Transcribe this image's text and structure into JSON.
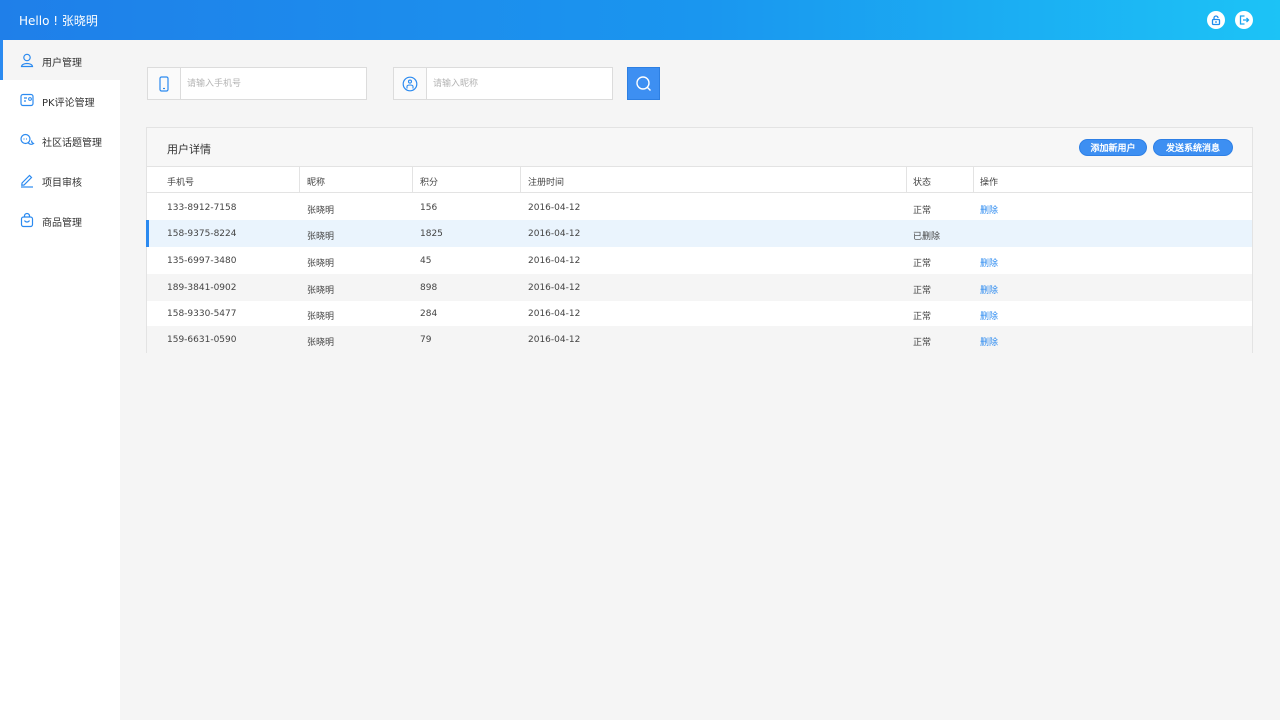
{
  "header": {
    "greeting": "Hello ! 张晓明",
    "lock_icon": "lock-icon",
    "logout_icon": "logout-icon"
  },
  "sidebar": {
    "items": [
      {
        "label": "用户管理",
        "icon": "user-icon",
        "active": true
      },
      {
        "label": "PK评论管理",
        "icon": "pk-icon",
        "active": false
      },
      {
        "label": "社区话题管理",
        "icon": "chat-icon",
        "active": false
      },
      {
        "label": "项目审核",
        "icon": "pencil-icon",
        "active": false
      },
      {
        "label": "商品管理",
        "icon": "bag-icon",
        "active": false
      }
    ]
  },
  "search": {
    "phone_placeholder": "请输入手机号",
    "nickname_placeholder": "请输入昵称",
    "phone_value": "",
    "nickname_value": ""
  },
  "panel": {
    "title": "用户详情",
    "add_user_label": "添加新用户",
    "send_message_label": "发送系统消息"
  },
  "table": {
    "columns": [
      "手机号",
      "昵称",
      "积分",
      "注册时间",
      "状态",
      "操作"
    ],
    "rows": [
      {
        "phone": "133-8912-7158",
        "nickname": "张晓明",
        "points": "156",
        "registered": "2016-04-12",
        "status": "正常",
        "action": "删除"
      },
      {
        "phone": "158-9375-8224",
        "nickname": "张晓明",
        "points": "1825",
        "registered": "2016-04-12",
        "status": "已删除",
        "action": ""
      },
      {
        "phone": "135-6997-3480",
        "nickname": "张晓明",
        "points": "45",
        "registered": "2016-04-12",
        "status": "正常",
        "action": "删除"
      },
      {
        "phone": "189-3841-0902",
        "nickname": "张晓明",
        "points": "898",
        "registered": "2016-04-12",
        "status": "正常",
        "action": "删除"
      },
      {
        "phone": "158-9330-5477",
        "nickname": "张晓明",
        "points": "284",
        "registered": "2016-04-12",
        "status": "正常",
        "action": "删除"
      },
      {
        "phone": "159-6631-0590",
        "nickname": "张晓明",
        "points": "79",
        "registered": "2016-04-12",
        "status": "正常",
        "action": "删除"
      }
    ]
  },
  "colors": {
    "accent": "#2b8af0",
    "header_start": "#1f7fe9",
    "header_end": "#1cc3f6"
  }
}
